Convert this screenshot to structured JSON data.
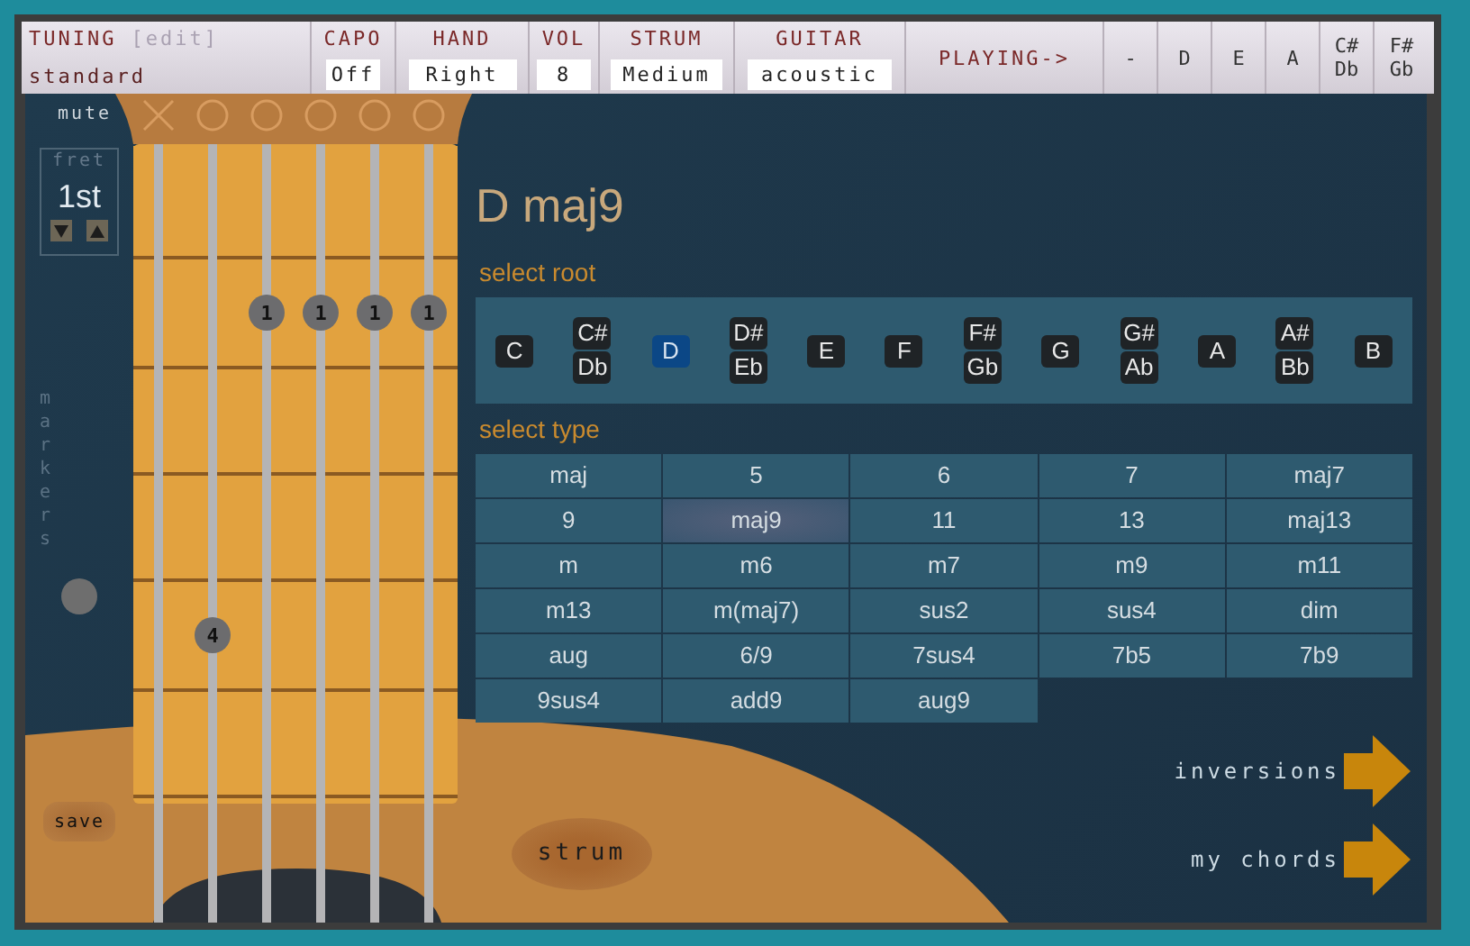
{
  "toolbar": {
    "tuning": {
      "label": "TUNING",
      "edit_link": "[edit]",
      "value": "standard"
    },
    "settings": [
      {
        "label": "CAPO",
        "value": "Off"
      },
      {
        "label": "HAND",
        "value": "Right"
      },
      {
        "label": "VOL",
        "value": "8"
      },
      {
        "label": "STRUM",
        "value": "Medium"
      },
      {
        "label": "GUITAR",
        "value": "acoustic"
      }
    ],
    "playing_label": "PLAYING->",
    "playing_notes": [
      {
        "name": "-"
      },
      {
        "name": "D"
      },
      {
        "name": "E"
      },
      {
        "name": "A"
      },
      {
        "name": "C#",
        "alt": "Db"
      },
      {
        "name": "F#",
        "alt": "Gb"
      }
    ]
  },
  "fretboard": {
    "mute_label": "mute",
    "fret_label": "fret",
    "fret_value": "1st",
    "markers_label": "markers",
    "strings": [
      {
        "muted": true
      },
      {
        "muted": false
      },
      {
        "muted": false
      },
      {
        "muted": false
      },
      {
        "muted": false
      },
      {
        "muted": false
      }
    ],
    "fret_rows": [
      {
        "spots": [
          {
            "pressed": false
          },
          {
            "pressed": false
          },
          {
            "pressed": false
          },
          {
            "pressed": false
          },
          {
            "pressed": false
          },
          {
            "pressed": false
          }
        ]
      },
      {
        "spots": [
          {
            "pressed": false
          },
          {
            "pressed": false
          },
          {
            "pressed": true,
            "finger": "1"
          },
          {
            "pressed": true,
            "finger": "1"
          },
          {
            "pressed": true,
            "finger": "1"
          },
          {
            "pressed": true,
            "finger": "1"
          }
        ]
      },
      {
        "spots": [
          {
            "pressed": false
          },
          {
            "pressed": false
          },
          {
            "pressed": false
          },
          {
            "pressed": false
          },
          {
            "pressed": false
          },
          {
            "pressed": false
          }
        ]
      },
      {
        "spots": [
          {
            "pressed": false
          },
          {
            "pressed": false
          },
          {
            "pressed": false
          },
          {
            "pressed": false
          },
          {
            "pressed": false
          },
          {
            "pressed": false
          }
        ]
      },
      {
        "spots": [
          {
            "pressed": false
          },
          {
            "pressed": true,
            "finger": "4"
          },
          {
            "pressed": false
          },
          {
            "pressed": false
          },
          {
            "pressed": false
          },
          {
            "pressed": false
          }
        ]
      },
      {
        "spots": [
          {
            "pressed": false
          },
          {
            "pressed": false
          },
          {
            "pressed": false
          },
          {
            "pressed": false
          },
          {
            "pressed": false
          },
          {
            "pressed": false
          }
        ]
      }
    ]
  },
  "save_label": "save",
  "strum_label": "strum",
  "chord": {
    "title": "D maj9",
    "root_label": "select root",
    "roots": [
      {
        "name": "C",
        "selected": false
      },
      {
        "name": "C#",
        "alt": "Db",
        "selected": false
      },
      {
        "name": "D",
        "selected": true
      },
      {
        "name": "D#",
        "alt": "Eb",
        "selected": false
      },
      {
        "name": "E",
        "selected": false
      },
      {
        "name": "F",
        "selected": false
      },
      {
        "name": "F#",
        "alt": "Gb",
        "selected": false
      },
      {
        "name": "G",
        "selected": false
      },
      {
        "name": "G#",
        "alt": "Ab",
        "selected": false
      },
      {
        "name": "A",
        "selected": false
      },
      {
        "name": "A#",
        "alt": "Bb",
        "selected": false
      },
      {
        "name": "B",
        "selected": false
      }
    ],
    "type_label": "select type",
    "types": [
      {
        "name": "maj",
        "selected": false
      },
      {
        "name": "5",
        "selected": false
      },
      {
        "name": "6",
        "selected": false
      },
      {
        "name": "7",
        "selected": false
      },
      {
        "name": "maj7",
        "selected": false
      },
      {
        "name": "9",
        "selected": false
      },
      {
        "name": "maj9",
        "selected": true
      },
      {
        "name": "11",
        "selected": false
      },
      {
        "name": "13",
        "selected": false
      },
      {
        "name": "maj13",
        "selected": false
      },
      {
        "name": "m",
        "selected": false
      },
      {
        "name": "m6",
        "selected": false
      },
      {
        "name": "m7",
        "selected": false
      },
      {
        "name": "m9",
        "selected": false
      },
      {
        "name": "m11",
        "selected": false
      },
      {
        "name": "m13",
        "selected": false
      },
      {
        "name": "m(maj7)",
        "selected": false
      },
      {
        "name": "sus2",
        "selected": false
      },
      {
        "name": "sus4",
        "selected": false
      },
      {
        "name": "dim",
        "selected": false
      },
      {
        "name": "aug",
        "selected": false
      },
      {
        "name": "6/9",
        "selected": false
      },
      {
        "name": "7sus4",
        "selected": false
      },
      {
        "name": "7b5",
        "selected": false
      },
      {
        "name": "7b9",
        "selected": false
      },
      {
        "name": "9sus4",
        "selected": false
      },
      {
        "name": "add9",
        "selected": false
      },
      {
        "name": "aug9",
        "selected": false
      }
    ]
  },
  "nav_buttons": [
    {
      "label": "inversions"
    },
    {
      "label": "my chords"
    }
  ]
}
